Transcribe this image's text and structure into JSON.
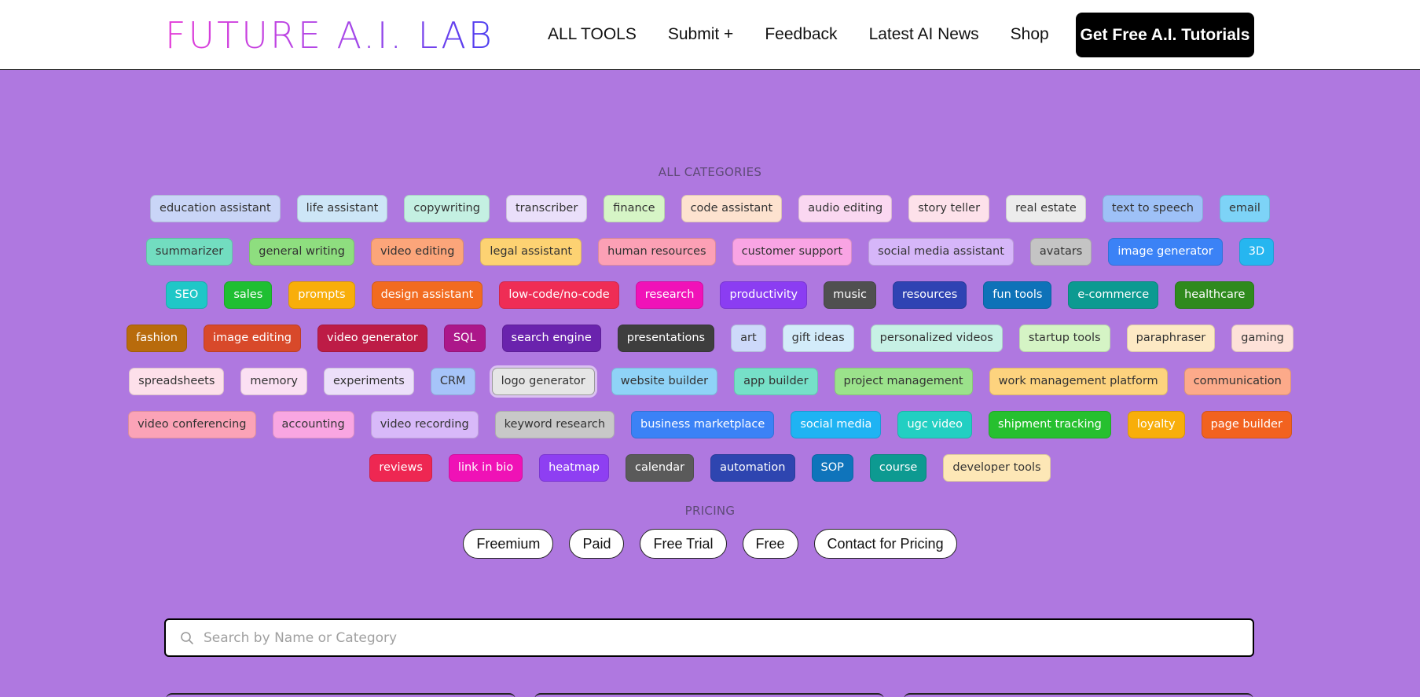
{
  "header": {
    "logo_text": "FUTURE A.I. LAB",
    "nav": [
      {
        "label": "ALL TOOLS"
      },
      {
        "label": "Submit +"
      },
      {
        "label": "Feedback"
      },
      {
        "label": "Latest AI News"
      },
      {
        "label": "Shop"
      }
    ],
    "cta_label": "Get Free A.I. Tutorials"
  },
  "categories": {
    "title": "ALL CATEGORIES",
    "rows": [
      [
        {
          "label": "education assistant",
          "bg": "#c9d5f7",
          "fg": "#333333"
        },
        {
          "label": "life assistant",
          "bg": "#cde6f7",
          "fg": "#333333"
        },
        {
          "label": "copywriting",
          "bg": "#c4f0e2",
          "fg": "#333333"
        },
        {
          "label": "transcriber",
          "bg": "#eadffa",
          "fg": "#333333"
        },
        {
          "label": "finance",
          "bg": "#d6f5c6",
          "fg": "#333333"
        },
        {
          "label": "code assistant",
          "bg": "#fde2cf",
          "fg": "#333333"
        },
        {
          "label": "audio editing",
          "bg": "#fad7f1",
          "fg": "#333333"
        },
        {
          "label": "story teller",
          "bg": "#fde1ea",
          "fg": "#333333"
        },
        {
          "label": "real estate",
          "bg": "#ececec",
          "fg": "#333333"
        },
        {
          "label": "text to speech",
          "bg": "#9ec1f7",
          "fg": "#333333"
        },
        {
          "label": "email",
          "bg": "#7dd3f7",
          "fg": "#333333"
        }
      ],
      [
        {
          "label": "summarizer",
          "bg": "#72ddc0",
          "fg": "#333333"
        },
        {
          "label": "general writing",
          "bg": "#8ede7f",
          "fg": "#333333"
        },
        {
          "label": "video editing",
          "bg": "#fca57a",
          "fg": "#333333"
        },
        {
          "label": "legal assistant",
          "bg": "#fdd272",
          "fg": "#333333"
        },
        {
          "label": "human resources",
          "bg": "#fca0b5",
          "fg": "#333333"
        },
        {
          "label": "customer support",
          "bg": "#f9a4e4",
          "fg": "#333333"
        },
        {
          "label": "social media assistant",
          "bg": "#d6b6f9",
          "fg": "#333333"
        },
        {
          "label": "avatars",
          "bg": "#c4c4c4",
          "fg": "#333333"
        },
        {
          "label": "image generator",
          "bg": "#3b82f6",
          "fg": "#ffffff"
        },
        {
          "label": "3D",
          "bg": "#26b6f0",
          "fg": "#ffffff"
        }
      ],
      [
        {
          "label": "SEO",
          "bg": "#1fc7c7",
          "fg": "#ffffff"
        },
        {
          "label": "sales",
          "bg": "#1fbf32",
          "fg": "#ffffff"
        },
        {
          "label": "prompts",
          "bg": "#f8ae0a",
          "fg": "#ffffff"
        },
        {
          "label": "design assistant",
          "bg": "#f26b20",
          "fg": "#ffffff"
        },
        {
          "label": "low-code/no-code",
          "bg": "#ef2d55",
          "fg": "#ffffff"
        },
        {
          "label": "research",
          "bg": "#f012b8",
          "fg": "#ffffff"
        },
        {
          "label": "productivity",
          "bg": "#8b3df2",
          "fg": "#ffffff"
        },
        {
          "label": "music",
          "bg": "#505050",
          "fg": "#ffffff"
        },
        {
          "label": "resources",
          "bg": "#2f43b3",
          "fg": "#ffffff"
        },
        {
          "label": "fun tools",
          "bg": "#0e72b8",
          "fg": "#ffffff"
        },
        {
          "label": "e-commerce",
          "bg": "#0c9a91",
          "fg": "#ffffff"
        },
        {
          "label": "healthcare",
          "bg": "#2f8a1d",
          "fg": "#ffffff"
        }
      ],
      [
        {
          "label": "fashion",
          "bg": "#b86b0c",
          "fg": "#ffffff"
        },
        {
          "label": "image editing",
          "bg": "#d8492a",
          "fg": "#ffffff"
        },
        {
          "label": "video generator",
          "bg": "#bd1c46",
          "fg": "#ffffff"
        },
        {
          "label": "SQL",
          "bg": "#ac178a",
          "fg": "#ffffff"
        },
        {
          "label": "search engine",
          "bg": "#6a23ad",
          "fg": "#ffffff"
        },
        {
          "label": "presentations",
          "bg": "#3e3e3e",
          "fg": "#ffffff"
        },
        {
          "label": "art",
          "bg": "#cdd9fa",
          "fg": "#333333"
        },
        {
          "label": "gift ideas",
          "bg": "#d3ecfa",
          "fg": "#333333"
        },
        {
          "label": "personalized videos",
          "bg": "#c7f1e5",
          "fg": "#333333"
        },
        {
          "label": "startup tools",
          "bg": "#d5f4c5",
          "fg": "#333333"
        },
        {
          "label": "paraphraser",
          "bg": "#fde9c4",
          "fg": "#333333"
        },
        {
          "label": "gaming",
          "bg": "#fde1d8",
          "fg": "#333333"
        }
      ],
      [
        {
          "label": "spreadsheets",
          "bg": "#fde0ea",
          "fg": "#333333"
        },
        {
          "label": "memory",
          "bg": "#fbe0f3",
          "fg": "#333333"
        },
        {
          "label": "experiments",
          "bg": "#ecdffa",
          "fg": "#333333"
        },
        {
          "label": "CRM",
          "bg": "#a6c4f9",
          "fg": "#333333"
        },
        {
          "label": "logo generator",
          "bg": "#e6e6e6",
          "fg": "#333333",
          "selected": true
        },
        {
          "label": "website builder",
          "bg": "#8fd3f7",
          "fg": "#333333"
        },
        {
          "label": "app builder",
          "bg": "#76e0c8",
          "fg": "#333333"
        },
        {
          "label": "project management",
          "bg": "#9be28b",
          "fg": "#333333"
        },
        {
          "label": "work management platform",
          "bg": "#fdd37e",
          "fg": "#333333"
        },
        {
          "label": "communication",
          "bg": "#fcaa8a",
          "fg": "#333333"
        }
      ],
      [
        {
          "label": "video conferencing",
          "bg": "#fba3b7",
          "fg": "#333333"
        },
        {
          "label": "accounting",
          "bg": "#f9a6e2",
          "fg": "#333333"
        },
        {
          "label": "video recording",
          "bg": "#d8b9f9",
          "fg": "#333333"
        },
        {
          "label": "keyword research",
          "bg": "#c8c8c8",
          "fg": "#333333"
        },
        {
          "label": "business marketplace",
          "bg": "#3b82f6",
          "fg": "#ffffff"
        },
        {
          "label": "social media",
          "bg": "#1fb3f3",
          "fg": "#ffffff"
        },
        {
          "label": "ugc video",
          "bg": "#22cfc2",
          "fg": "#ffffff"
        },
        {
          "label": "shipment tracking",
          "bg": "#26c02f",
          "fg": "#ffffff"
        },
        {
          "label": "loyalty",
          "bg": "#f8ae0a",
          "fg": "#ffffff"
        },
        {
          "label": "page builder",
          "bg": "#f2621f",
          "fg": "#ffffff"
        }
      ],
      [
        {
          "label": "reviews",
          "bg": "#ee2752",
          "fg": "#ffffff"
        },
        {
          "label": "link in bio",
          "bg": "#ef12b6",
          "fg": "#ffffff"
        },
        {
          "label": "heatmap",
          "bg": "#8e3ff2",
          "fg": "#ffffff"
        },
        {
          "label": "calendar",
          "bg": "#5a5a5a",
          "fg": "#ffffff"
        },
        {
          "label": "automation",
          "bg": "#2e45b0",
          "fg": "#ffffff"
        },
        {
          "label": "SOP",
          "bg": "#0f74bb",
          "fg": "#ffffff"
        },
        {
          "label": "course",
          "bg": "#0d9a91",
          "fg": "#ffffff"
        },
        {
          "label": "developer tools",
          "bg": "#fde7b6",
          "fg": "#333333"
        }
      ]
    ]
  },
  "pricing": {
    "title": "PRICING",
    "options": [
      "Freemium",
      "Paid",
      "Free Trial",
      "Free",
      "Contact for Pricing"
    ]
  },
  "search": {
    "placeholder": "Search by Name or Category",
    "value": ""
  }
}
